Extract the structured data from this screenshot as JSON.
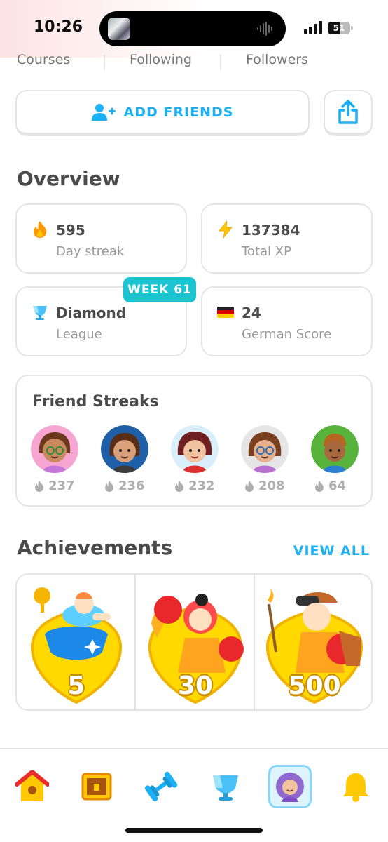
{
  "status_bar": {
    "time": "10:26",
    "battery": "51"
  },
  "top_tabs": [
    "Courses",
    "Following",
    "Followers"
  ],
  "add_friends_label": "ADD FRIENDS",
  "overview": {
    "title": "Overview",
    "stats": [
      {
        "value": "595",
        "label": "Day streak",
        "icon": "fire-icon"
      },
      {
        "value": "137384",
        "label": "Total XP",
        "icon": "lightning-icon"
      },
      {
        "value": "Diamond",
        "label": "League",
        "icon": "diamond-trophy-icon"
      },
      {
        "value": "24",
        "label": "German Score",
        "icon": "germany-flag-icon"
      }
    ],
    "week_badge": "WEEK 61"
  },
  "friend_streaks": {
    "title": "Friend Streaks",
    "friends": [
      {
        "count": "237",
        "bg": "#f7a6d1"
      },
      {
        "count": "236",
        "bg": "#1e5fa8"
      },
      {
        "count": "232",
        "bg": "#d8eefa"
      },
      {
        "count": "208",
        "bg": "#e5e5e5"
      },
      {
        "count": "64",
        "bg": "#58b33d"
      }
    ]
  },
  "achievements": {
    "title": "Achievements",
    "view_all": "VIEW ALL",
    "items": [
      {
        "value": "5"
      },
      {
        "value": "30"
      },
      {
        "value": "500"
      }
    ]
  },
  "nav": [
    "home-icon",
    "treasure-chest-icon",
    "dumbbell-icon",
    "league-trophy-icon",
    "profile-avatar-icon",
    "bell-icon"
  ],
  "colors": {
    "accent": "#1cb0f6",
    "badge": "#1cc4d1",
    "border": "#e5e5e5"
  }
}
